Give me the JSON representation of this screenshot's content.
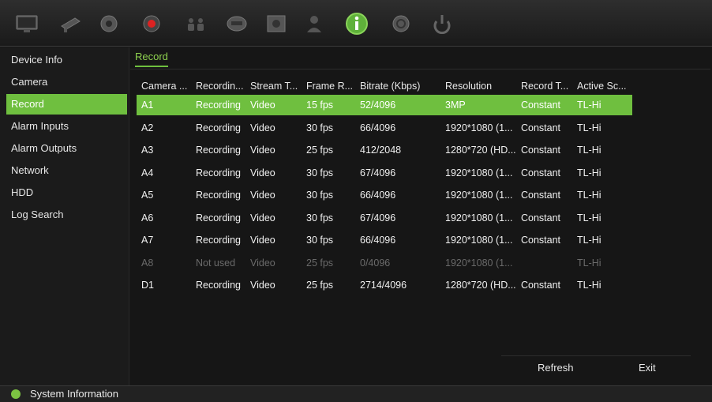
{
  "toolbar": {
    "icons": [
      "monitor-icon",
      "ptz-camera-icon",
      "dome-camera-icon",
      "record-icon",
      "people-icon",
      "hdd-icon",
      "snapshot-icon",
      "user-icon",
      "info-icon",
      "help-icon",
      "power-icon"
    ],
    "active_icon": "info-icon"
  },
  "sidebar": {
    "items": [
      {
        "label": "Device Info"
      },
      {
        "label": "Camera"
      },
      {
        "label": "Record"
      },
      {
        "label": "Alarm Inputs"
      },
      {
        "label": "Alarm Outputs"
      },
      {
        "label": "Network"
      },
      {
        "label": "HDD"
      },
      {
        "label": "Log Search"
      }
    ],
    "active_index": 2
  },
  "main": {
    "tab_label": "Record",
    "columns": [
      "Camera ...",
      "Recordin...",
      "Stream T...",
      "Frame R...",
      "Bitrate (Kbps)",
      "Resolution",
      "Record T...",
      "Active Sc..."
    ],
    "rows": [
      [
        "A1",
        "Recording",
        "Video",
        "15 fps",
        "52/4096",
        "3MP",
        "Constant",
        "TL-Hi"
      ],
      [
        "A2",
        "Recording",
        "Video",
        "30 fps",
        "66/4096",
        "1920*1080 (1...",
        "Constant",
        "TL-Hi"
      ],
      [
        "A3",
        "Recording",
        "Video",
        "25 fps",
        "412/2048",
        "1280*720 (HD...",
        "Constant",
        "TL-Hi"
      ],
      [
        "A4",
        "Recording",
        "Video",
        "30 fps",
        "67/4096",
        "1920*1080 (1...",
        "Constant",
        "TL-Hi"
      ],
      [
        "A5",
        "Recording",
        "Video",
        "30 fps",
        "66/4096",
        "1920*1080 (1...",
        "Constant",
        "TL-Hi"
      ],
      [
        "A6",
        "Recording",
        "Video",
        "30 fps",
        "67/4096",
        "1920*1080 (1...",
        "Constant",
        "TL-Hi"
      ],
      [
        "A7",
        "Recording",
        "Video",
        "30 fps",
        "66/4096",
        "1920*1080 (1...",
        "Constant",
        "TL-Hi"
      ],
      [
        "A8",
        "Not used",
        "Video",
        "25 fps",
        "0/4096",
        "1920*1080 (1...",
        "",
        "TL-Hi"
      ],
      [
        "D1",
        "Recording",
        "Video",
        "25 fps",
        "2714/4096",
        "1280*720 (HD...",
        "Constant",
        "TL-Hi"
      ]
    ],
    "selected_row": 0,
    "disabled_rows": [
      7
    ],
    "refresh_label": "Refresh",
    "exit_label": "Exit"
  },
  "statusbar": {
    "text": "System Information"
  },
  "colors": {
    "accent": "#6fbf3f",
    "background": "#161616",
    "disabled_text": "#6a6a6a"
  }
}
